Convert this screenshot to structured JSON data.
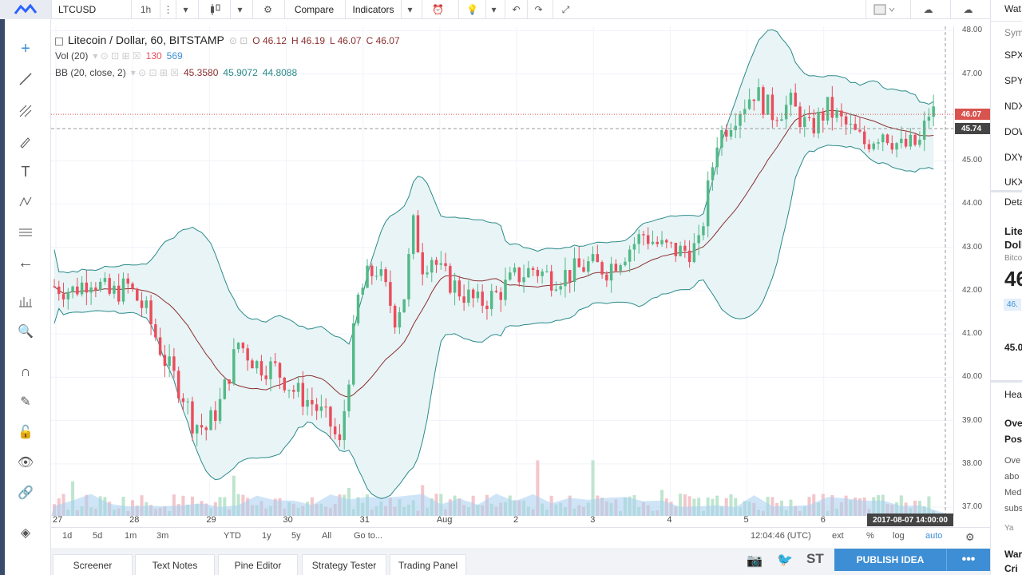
{
  "toolbar": {
    "symbol": "LTCUSD",
    "interval": "1h",
    "compare": "Compare",
    "indicators": "Indicators"
  },
  "legend": {
    "title": "Litecoin / Dollar, 60, BITSTAMP",
    "ohlc": {
      "o": "O 46.12",
      "h": "H 46.19",
      "l": "L 46.07",
      "c": "C 46.07"
    },
    "vol": {
      "label": "Vol (20)",
      "v1": "130",
      "v2": "569"
    },
    "bb": {
      "label": "BB (20, close, 2)",
      "mid": "45.3580",
      "upper": "45.9072",
      "lower": "44.8088"
    }
  },
  "price_axis": {
    "ticks": [
      "48.00",
      "47.00",
      "46.00",
      "45.00",
      "44.00",
      "43.00",
      "42.00",
      "41.00",
      "40.00",
      "39.00",
      "38.00",
      "37.00"
    ],
    "last_price": "46.07",
    "cursor_price": "45.74",
    "last_color": "#d9534f",
    "cursor_color": "#444444"
  },
  "time_axis": {
    "ticks": [
      "27",
      "28",
      "29",
      "30",
      "31",
      "Aug",
      "2",
      "3",
      "4",
      "5",
      "6"
    ],
    "cursor_time": "2017-08-07 14:00:00"
  },
  "range_bar": {
    "items": [
      "1d",
      "5d",
      "1m",
      "3m",
      "YTD",
      "1y",
      "5y",
      "All"
    ],
    "goto": "Go to...",
    "clock": "12:04:46 (UTC)",
    "ext": "ext",
    "pct": "%",
    "log": "log",
    "auto": "auto"
  },
  "bottom_tabs": [
    "Screener",
    "Text Notes",
    "Pine Editor",
    "Strategy Tester",
    "Trading Panel"
  ],
  "bottom": {
    "st": "ST",
    "publish": "PUBLISH IDEA",
    "more": "•••"
  },
  "right_panel": {
    "watch": "Wat",
    "sym": "Sym",
    "symbols": [
      "SPX",
      "SPY",
      "NDX",
      "DOW",
      "DXY",
      "UKX"
    ],
    "det": "Deta",
    "name1": "Lite",
    "name2": "Doll",
    "exchange": "Bitco",
    "price": "46",
    "chg": "46.",
    "val": "45.0",
    "hea": "Hea",
    "news1": "Ove",
    "news2": "Pos",
    "n3": "Ove",
    "n4": "abo",
    "n5": "Med",
    "n6": "subs",
    "n7": "Ya",
    "n8": "War",
    "n9": "Cri"
  },
  "colors": {
    "up": "#53b987",
    "down": "#eb4d5c",
    "band": "#2b8a8a",
    "basis": "#8b2f2f",
    "accent": "#3d8ed4"
  },
  "chart_data": {
    "type": "candlestick",
    "x_labels": [
      "27",
      "28",
      "29",
      "30",
      "31",
      "Aug",
      "2",
      "3",
      "4",
      "5",
      "6"
    ],
    "ylim": [
      36.8,
      48.1
    ],
    "close_path": [
      [
        0,
        42.1
      ],
      [
        4,
        42.0
      ],
      [
        8,
        42.3
      ],
      [
        12,
        41.9
      ],
      [
        16,
        42.1
      ],
      [
        20,
        41.5
      ],
      [
        24,
        40.4
      ],
      [
        28,
        39.6
      ],
      [
        30,
        39.0
      ],
      [
        33,
        38.8
      ],
      [
        36,
        39.4
      ],
      [
        40,
        40.8
      ],
      [
        44,
        40.3
      ],
      [
        48,
        40.2
      ],
      [
        52,
        39.7
      ],
      [
        56,
        39.4
      ],
      [
        60,
        38.9
      ],
      [
        62,
        38.4
      ],
      [
        64,
        40.1
      ],
      [
        66,
        41.8
      ],
      [
        68,
        42.3
      ],
      [
        70,
        42.5
      ],
      [
        72,
        42.0
      ],
      [
        74,
        41.4
      ],
      [
        76,
        41.9
      ],
      [
        78,
        43.5
      ],
      [
        80,
        42.6
      ],
      [
        82,
        42.8
      ],
      [
        84,
        42.4
      ],
      [
        88,
        42.0
      ],
      [
        92,
        41.7
      ],
      [
        96,
        41.9
      ],
      [
        100,
        42.3
      ],
      [
        104,
        42.5
      ],
      [
        108,
        42.3
      ],
      [
        112,
        42.4
      ],
      [
        116,
        42.6
      ],
      [
        120,
        42.5
      ],
      [
        124,
        42.9
      ],
      [
        128,
        43.3
      ],
      [
        132,
        43.0
      ],
      [
        136,
        42.9
      ],
      [
        140,
        43.0
      ],
      [
        142,
        44.3
      ],
      [
        144,
        45.5
      ],
      [
        148,
        46.1
      ],
      [
        152,
        46.6
      ],
      [
        156,
        46.1
      ],
      [
        160,
        46.3
      ],
      [
        164,
        45.7
      ],
      [
        168,
        46.2
      ],
      [
        172,
        45.8
      ],
      [
        176,
        45.4
      ],
      [
        180,
        45.7
      ],
      [
        184,
        45.3
      ],
      [
        188,
        45.4
      ],
      [
        190,
        46.1
      ]
    ],
    "count": 192,
    "volume_scale": [
      0,
      1
    ],
    "ma_period": 20,
    "bb_mult": 2
  }
}
